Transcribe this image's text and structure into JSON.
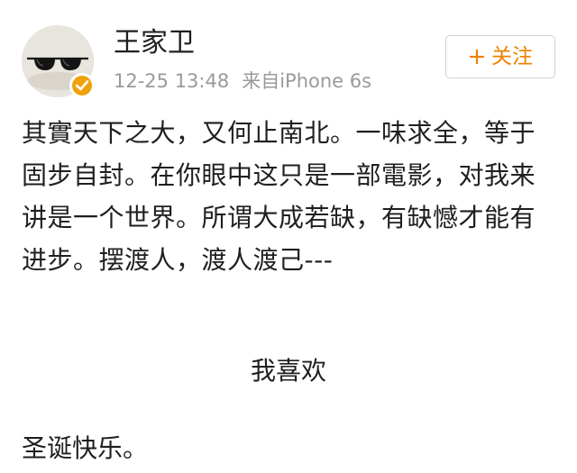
{
  "post": {
    "author": {
      "name": "王家卫",
      "verified": true,
      "avatar_icon": "sunglasses-avatar"
    },
    "timestamp": "12-25 13:48",
    "source": "来自iPhone 6s",
    "follow_button": {
      "label": "关注",
      "icon": "plus-icon"
    },
    "content": {
      "paragraph": "其實天下之大，又何止南北。一味求全，等于固步自封。在你眼中这只是一部電影，对我来讲是一个世界。所谓大成若缺，有缺憾才能有进步。摆渡人，渡人渡己---",
      "centered_line": "我喜欢",
      "closing_line": "圣诞快乐。"
    }
  },
  "colors": {
    "accent": "#ef8200",
    "verified": "#f0a20b",
    "meta_text": "#9a9a9a",
    "body_text": "#1f1f1f"
  }
}
